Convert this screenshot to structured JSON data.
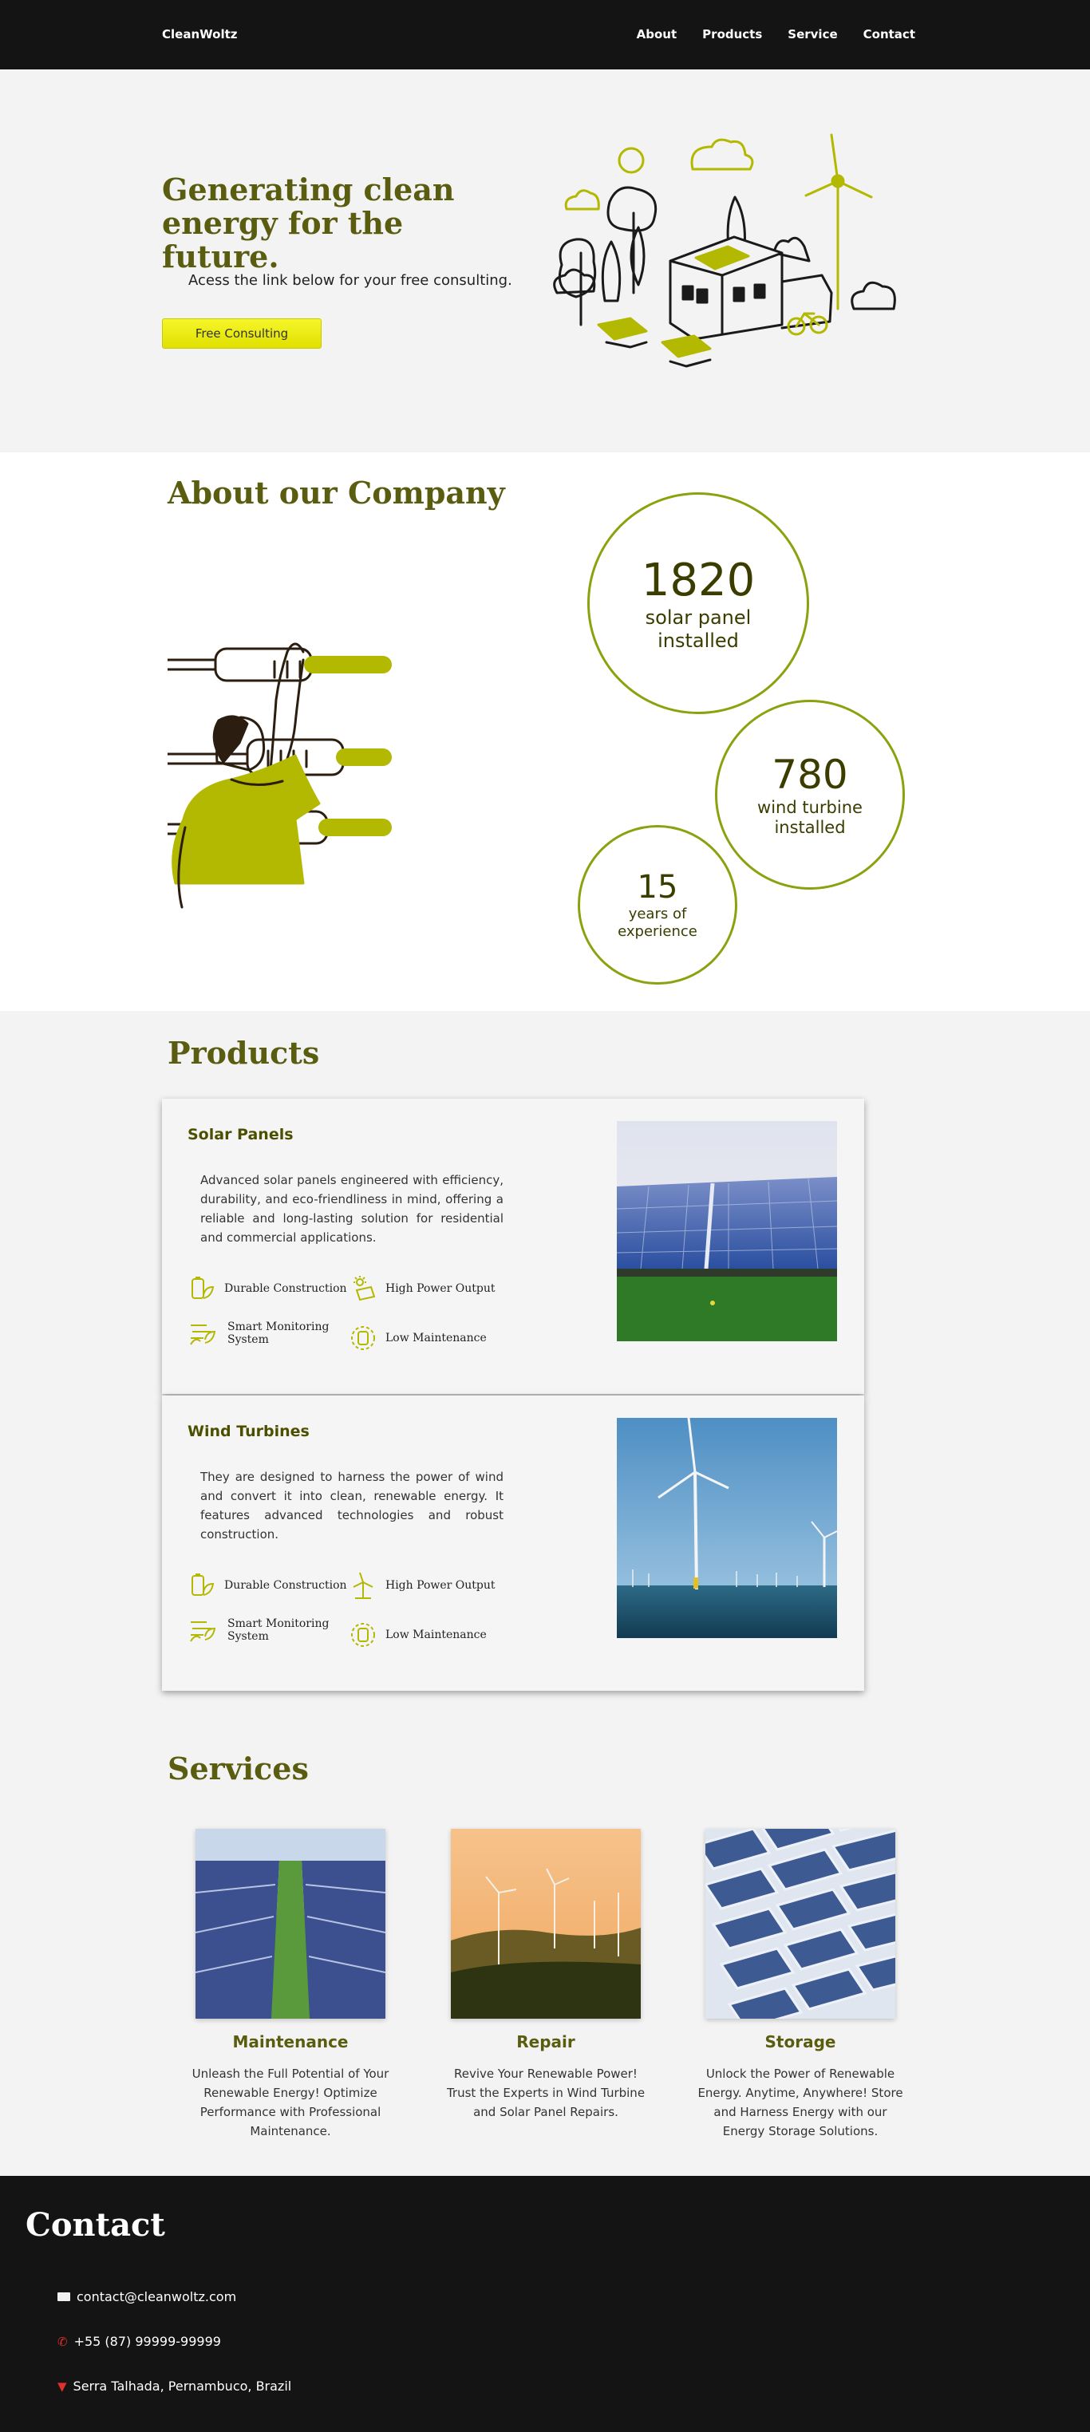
{
  "nav": {
    "brand": "CleanWoltz",
    "links": [
      "About",
      "Products",
      "Service",
      "Contact"
    ]
  },
  "hero": {
    "title": "Generating clean energy for the future.",
    "subtitle": "Acess the link below for your free consulting.",
    "cta_label": "Free Consulting"
  },
  "about": {
    "title": "About our Company",
    "stats": [
      {
        "number": "1820",
        "label": "solar panel installed"
      },
      {
        "number": "780",
        "label": "wind turbine installed"
      },
      {
        "number": "15",
        "label": "years of experience"
      }
    ]
  },
  "products": {
    "title": "Products",
    "items": [
      {
        "name": "Solar Panels",
        "description": "Advanced solar panels engineered with efficiency, durability, and eco-friendliness in mind, offering a reliable and long-lasting solution for residential and commercial applications.",
        "features": [
          "Durable Construction",
          "High Power Output",
          "Smart Monitoring System",
          "Low Maintenance"
        ]
      },
      {
        "name": "Wind Turbines",
        "description": "They are designed to harness the power of wind and convert it into clean, renewable energy. It features advanced technologies and robust construction.",
        "features": [
          "Durable Construction",
          "High Power Output",
          "Smart Monitoring System",
          "Low Maintenance"
        ]
      }
    ]
  },
  "services": {
    "title": "Services",
    "items": [
      {
        "name": "Maintenance",
        "description": "Unleash the Full Potential of Your Renewable Energy! Optimize Performance with Professional Maintenance."
      },
      {
        "name": "Repair",
        "description": "Revive Your Renewable Power! Trust the Experts in Wind Turbine and Solar Panel Repairs."
      },
      {
        "name": "Storage",
        "description": "Unlock the Power of Renewable Energy. Anytime, Anywhere! Store and Harness Energy with our Energy Storage Solutions."
      }
    ]
  },
  "contact": {
    "title": "Contact",
    "email": "contact@cleanwoltz.com",
    "phone": "+55 (87) 99999-99999",
    "address": "Serra Talhada, Pernambuco, Brazil"
  },
  "colors": {
    "accent": "#b3b800",
    "title_olive": "#5a5c10",
    "dark": "#141414"
  }
}
